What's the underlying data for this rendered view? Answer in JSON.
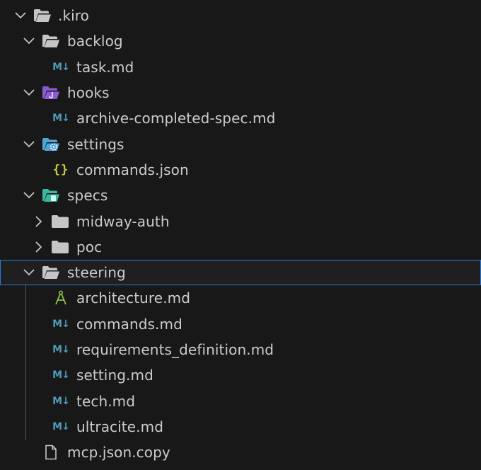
{
  "explorer": {
    "root": {
      "label": ".kiro",
      "expanded": true
    },
    "items": [
      {
        "label": "backlog",
        "kind": "folder",
        "expanded": true,
        "icon": "folder-open-icon"
      },
      {
        "label": "task.md",
        "kind": "file",
        "icon": "markdown-icon"
      },
      {
        "label": "hooks",
        "kind": "folder",
        "expanded": true,
        "icon": "hooks-folder-open-icon"
      },
      {
        "label": "archive-completed-spec.md",
        "kind": "file",
        "icon": "markdown-icon"
      },
      {
        "label": "settings",
        "kind": "folder",
        "expanded": true,
        "icon": "settings-folder-open-icon"
      },
      {
        "label": "commands.json",
        "kind": "file",
        "icon": "json-icon"
      },
      {
        "label": "specs",
        "kind": "folder",
        "expanded": true,
        "icon": "specs-folder-open-icon"
      },
      {
        "label": "midway-auth",
        "kind": "folder",
        "expanded": false,
        "icon": "folder-icon"
      },
      {
        "label": "poc",
        "kind": "folder",
        "expanded": false,
        "icon": "folder-icon"
      },
      {
        "label": "steering",
        "kind": "folder",
        "expanded": true,
        "focused": true,
        "icon": "folder-open-icon"
      },
      {
        "label": "architecture.md",
        "kind": "file",
        "icon": "architecture-icon"
      },
      {
        "label": "commands.md",
        "kind": "file",
        "icon": "markdown-icon"
      },
      {
        "label": "requirements_definition.md",
        "kind": "file",
        "icon": "markdown-icon"
      },
      {
        "label": "setting.md",
        "kind": "file",
        "icon": "markdown-icon"
      },
      {
        "label": "tech.md",
        "kind": "file",
        "icon": "markdown-icon"
      },
      {
        "label": "ultracite.md",
        "kind": "file",
        "icon": "markdown-icon"
      },
      {
        "label": "mcp.json.copy",
        "kind": "file",
        "icon": "file-icon"
      }
    ],
    "colors": {
      "background": "#181818",
      "text": "#cccccc",
      "focus_border": "#2b79d6",
      "folder": "#c5c5c5",
      "hooks_folder": "#8a5cd1",
      "settings_folder": "#4fa6d6",
      "specs_folder": "#3bb8a0",
      "markdown": "#519aba",
      "json": "#cbcb41",
      "architecture": "#8dc149"
    }
  }
}
